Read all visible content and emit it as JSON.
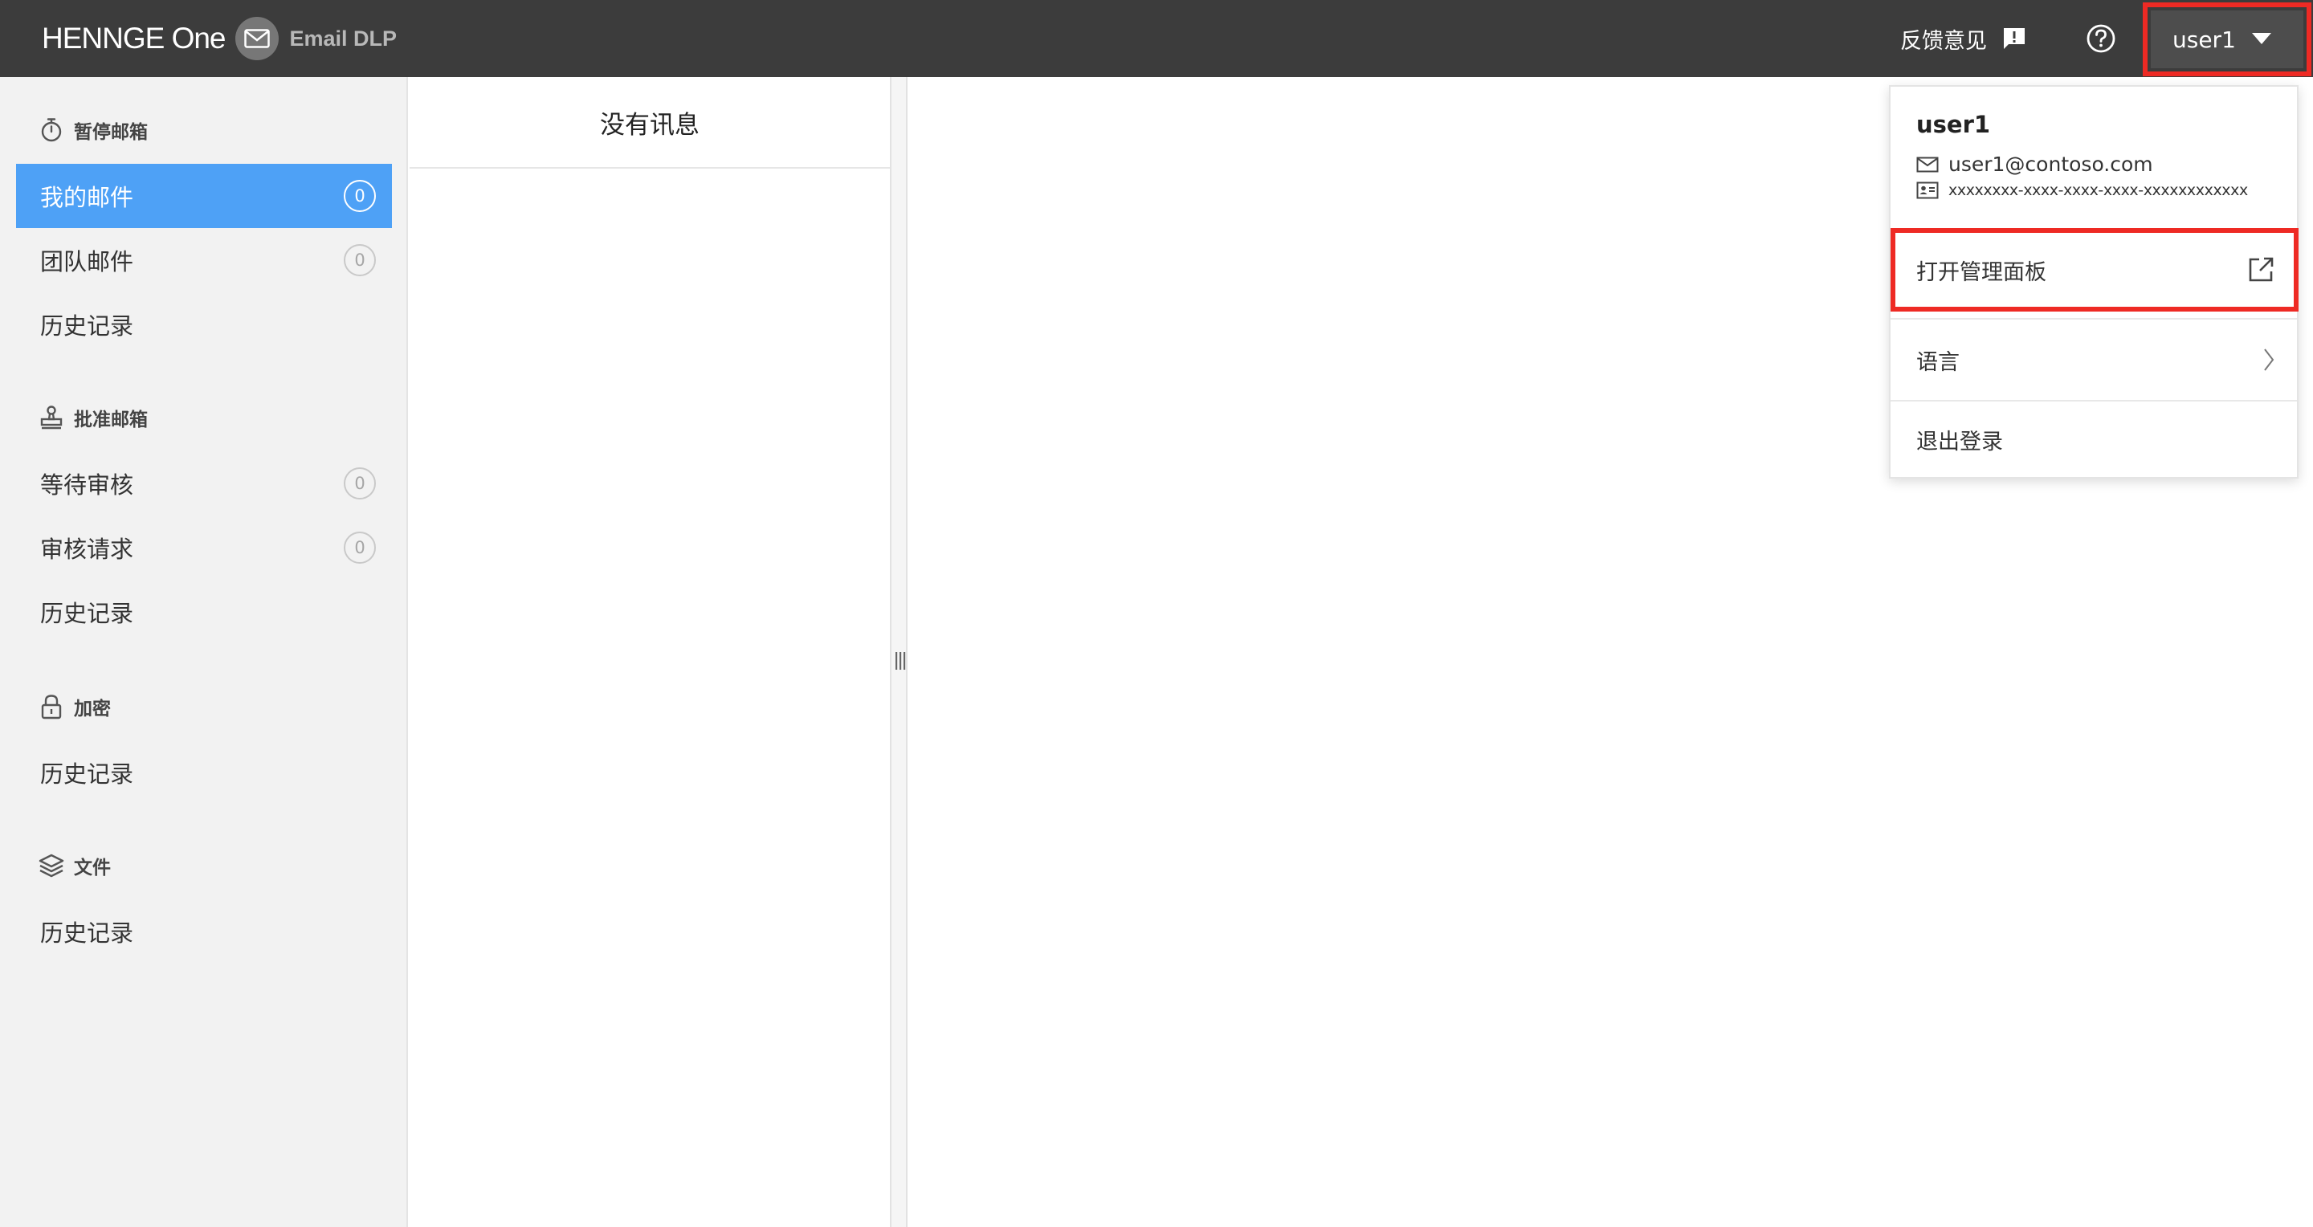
{
  "topbar": {
    "brand_logo": "HENNGE One",
    "brand_product": "Email DLP",
    "feedback_label": "反馈意见",
    "username": "user1"
  },
  "sidebar": {
    "sections": [
      {
        "title": "暂停邮箱",
        "icon": "stopwatch-icon",
        "items": [
          {
            "label": "我的邮件",
            "count": "0",
            "active": true
          },
          {
            "label": "团队邮件",
            "count": "0"
          },
          {
            "label": "历史记录"
          }
        ]
      },
      {
        "title": "批准邮箱",
        "icon": "stamp-icon",
        "items": [
          {
            "label": "等待审核",
            "count": "0"
          },
          {
            "label": "审核请求",
            "count": "0"
          },
          {
            "label": "历史记录"
          }
        ]
      },
      {
        "title": "加密",
        "icon": "lock-icon",
        "items": [
          {
            "label": "历史记录"
          }
        ]
      },
      {
        "title": "文件",
        "icon": "layers-icon",
        "items": [
          {
            "label": "历史记录"
          }
        ]
      }
    ]
  },
  "message_list": {
    "empty_text": "没有讯息"
  },
  "user_menu": {
    "username": "user1",
    "email": "user1@contoso.com",
    "user_id": "xxxxxxxx-xxxx-xxxx-xxxx-xxxxxxxxxxxx",
    "open_admin_label": "打开管理面板",
    "language_label": "语言",
    "logout_label": "退出登录"
  },
  "colors": {
    "topbar": "#3c3c3c",
    "active_item": "#4ea1f6",
    "highlight": "#ee2a24",
    "sidebar_bg": "#f2f2f2"
  }
}
